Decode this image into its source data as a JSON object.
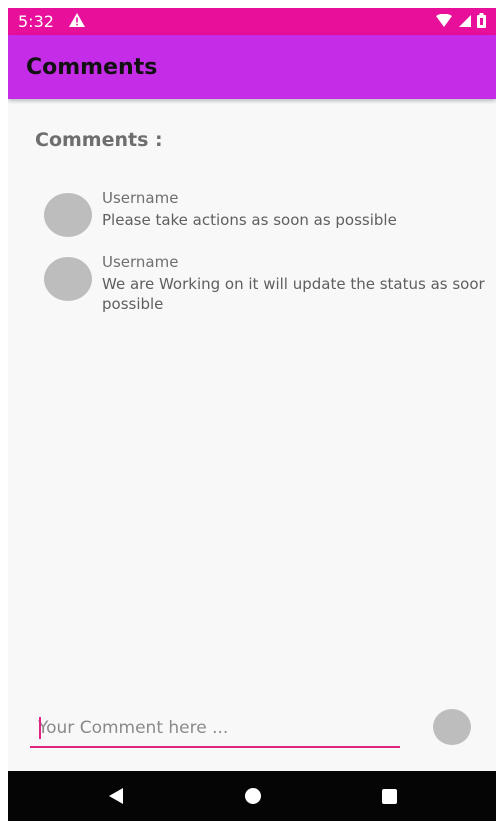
{
  "status_bar": {
    "time": "5:32",
    "background_color": "#e80f9a",
    "icons": [
      "alert-icon",
      "wifi-icon",
      "signal-icon",
      "battery-icon"
    ]
  },
  "app_bar": {
    "title": "Comments",
    "background_color": "#c42ce8"
  },
  "section_title": "Comments :",
  "comments": [
    {
      "username": "Username",
      "text": "Please take actions as soon as possible"
    },
    {
      "username": "Username",
      "text": "We are Working on it will update the status as soor possible"
    }
  ],
  "comment_input": {
    "placeholder": "Your Comment here ...",
    "value": "",
    "accent_color": "#e0247f"
  },
  "nav_bar": {
    "icons": [
      "back-icon",
      "home-icon",
      "recents-icon"
    ]
  }
}
